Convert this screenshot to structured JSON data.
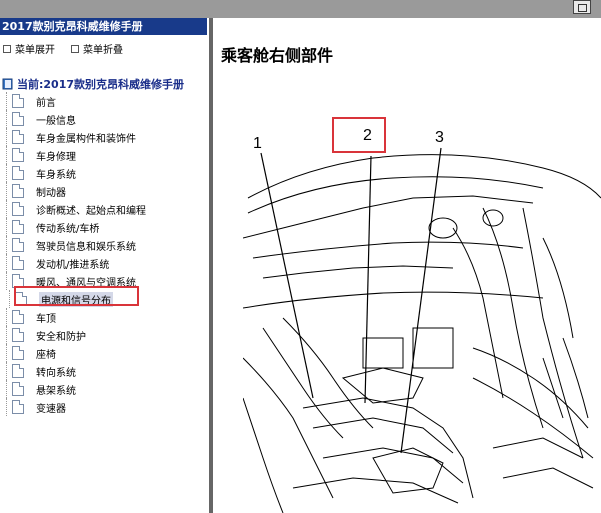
{
  "sidebar": {
    "header": "2017款别克昂科威维修手册",
    "expand_label": "菜单展开",
    "collapse_label": "菜单折叠",
    "root_label": "当前:2017款别克昂科威维修手册",
    "items": [
      {
        "label": "前言"
      },
      {
        "label": "一般信息"
      },
      {
        "label": "车身金属构件和装饰件"
      },
      {
        "label": "车身修理"
      },
      {
        "label": "车身系统"
      },
      {
        "label": "制动器"
      },
      {
        "label": "诊断概述、起始点和编程"
      },
      {
        "label": "传动系统/车桥"
      },
      {
        "label": "驾驶员信息和娱乐系统"
      },
      {
        "label": "发动机/推进系统"
      },
      {
        "label": "暖风、通风与空调系统"
      },
      {
        "label": "电源和信号分布",
        "selected": true
      },
      {
        "label": "车顶"
      },
      {
        "label": "安全和防护"
      },
      {
        "label": "座椅"
      },
      {
        "label": "转向系统"
      },
      {
        "label": "悬架系统"
      },
      {
        "label": "变速器"
      }
    ]
  },
  "content": {
    "title": "乘客舱右侧部件",
    "callouts": [
      "1",
      "2",
      "3"
    ]
  }
}
